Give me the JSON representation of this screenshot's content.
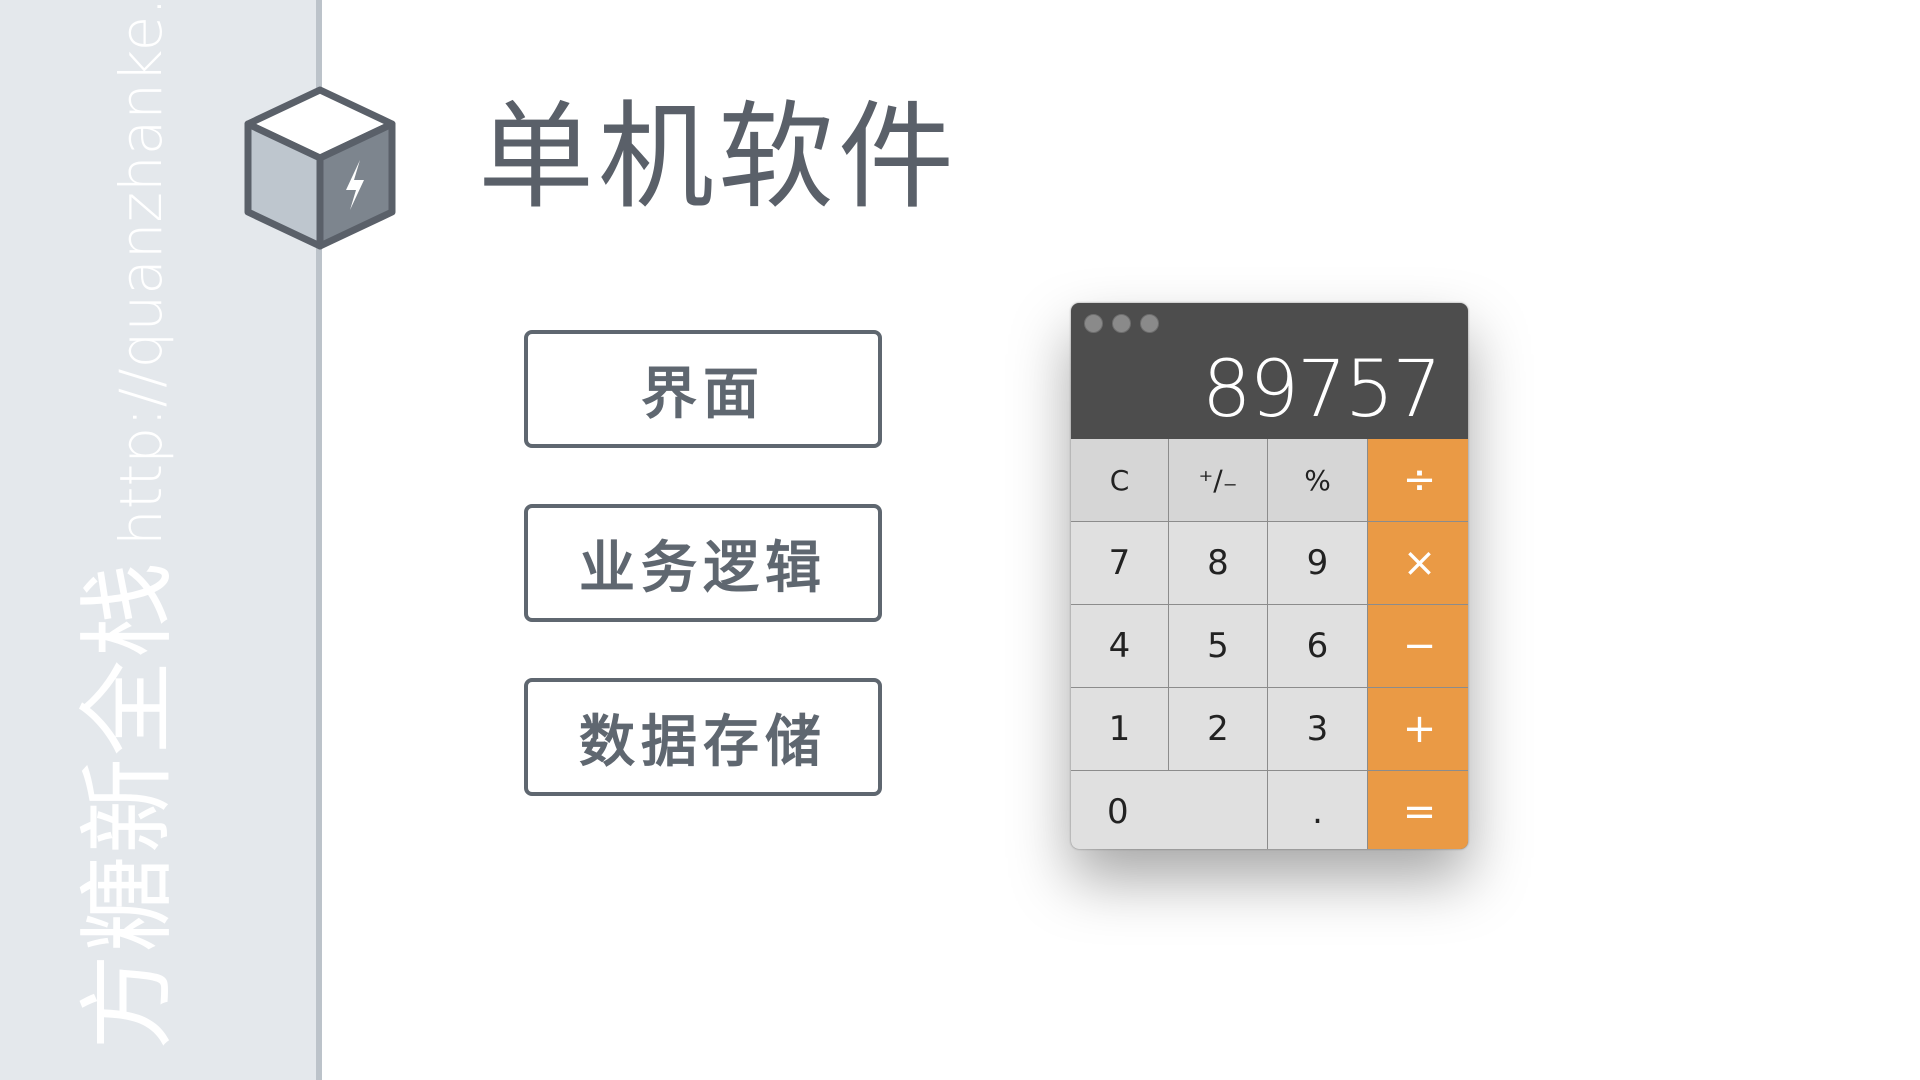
{
  "sidebar": {
    "brand": "方糖新全栈",
    "url": "http://quanzhanke.com"
  },
  "title": "单机软件",
  "layers": [
    {
      "label": "界面"
    },
    {
      "label": "业务逻辑"
    },
    {
      "label": "数据存储"
    }
  ],
  "calculator": {
    "display": "89757",
    "keys": {
      "clear": "C",
      "sign": "⁺∕₋",
      "percent": "%",
      "divide": "÷",
      "seven": "7",
      "eight": "8",
      "nine": "9",
      "multiply": "×",
      "four": "4",
      "five": "5",
      "six": "6",
      "minus": "−",
      "one": "1",
      "two": "2",
      "three": "3",
      "plus": "+",
      "zero": "0",
      "dot": ".",
      "equals": "="
    }
  },
  "colors": {
    "sidebar_bg": "#e4e8ec",
    "accent_orange": "#ea9a45",
    "text_gray": "#5f6770",
    "calc_dark": "#4d4d4d"
  },
  "icons": [
    "cube-lightning-icon"
  ]
}
